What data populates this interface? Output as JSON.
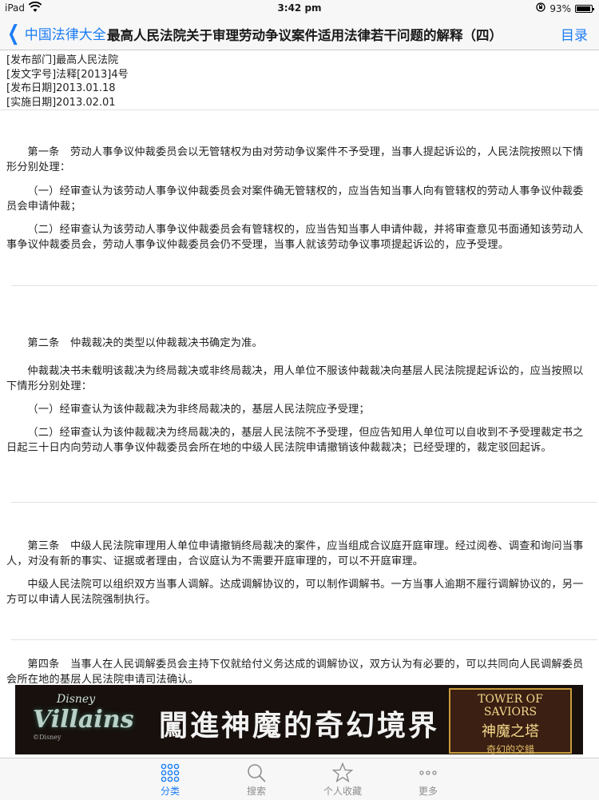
{
  "status": {
    "carrier": "iPad",
    "time": "3:42 pm",
    "battery": "93%",
    "battery_level": 0.93
  },
  "nav": {
    "back_label": "中国法律大全",
    "title": "最高人民法院关于审理劳动争议案件适用法律若干问题的解释（四）",
    "toc_label": "目录"
  },
  "meta": {
    "dept": "[发布部门]最高人民法院",
    "doc_no": "[发文字号]法释[2013]4号",
    "pub_date": "[发布日期]2013.01.18",
    "eff_date": "[实施日期]2013.02.01"
  },
  "articles": {
    "a1_p1": "第一条　劳动人事争议仲裁委员会以无管辖权为由对劳动争议案件不予受理，当事人提起诉讼的，人民法院按照以下情形分别处理：",
    "a1_p2": "（一）经审查认为该劳动人事争议仲裁委员会对案件确无管辖权的，应当告知当事人向有管辖权的劳动人事争议仲裁委员会申请仲裁；",
    "a1_p3": "（二）经审查认为该劳动人事争议仲裁委员会有管辖权的，应当告知当事人申请仲裁，并将审查意见书面通知该劳动人事争议仲裁委员会，劳动人事争议仲裁委员会仍不受理，当事人就该劳动争议事项提起诉讼的，应予受理。",
    "a2_p1": "第二条　仲裁裁决的类型以仲裁裁决书确定为准。",
    "a2_p2": "仲裁裁决书未载明该裁决为终局裁决或非终局裁决，用人单位不服该仲裁裁决向基层人民法院提起诉讼的，应当按照以下情形分别处理：",
    "a2_p3": "（一）经审查认为该仲裁裁决为非终局裁决的，基层人民法院应予受理；",
    "a2_p4": "（二）经审查认为该仲裁裁决为终局裁决的，基层人民法院不予受理，但应告知用人单位可以自收到不予受理裁定书之日起三十日内向劳动人事争议仲裁委员会所在地的中级人民法院申请撤销该仲裁裁决；已经受理的，裁定驳回起诉。",
    "a3_p1": "第三条　中级人民法院审理用人单位申请撤销终局裁决的案件，应当组成合议庭开庭审理。经过阅卷、调查和询问当事人，对没有新的事实、证据或者理由，合议庭认为不需要开庭审理的，可以不开庭审理。",
    "a3_p2": "中级人民法院可以组织双方当事人调解。达成调解协议的，可以制作调解书。一方当事人逾期不履行调解协议的，另一方可以申请人民法院强制执行。",
    "a4_p1": "第四条　当事人在人民调解委员会主持下仅就给付义务达成的调解协议，双方认为有必要的，可以共同向人民调解委员会所在地的基层人民法院申请司法确认。"
  },
  "ad": {
    "brand_small": "Disney",
    "brand_big": "Villains",
    "copyright": "©Disney",
    "headline": "闖進神魔的奇幻境界",
    "game_en": "TOWER OF SAVIORS",
    "game_cn": "神魔之塔",
    "game_sub": "奇幻的交錯"
  },
  "tabs": {
    "t1": "分类",
    "t2": "搜索",
    "t3": "个人收藏",
    "t4": "更多"
  },
  "colors": {
    "accent": "#1b7cf5",
    "tab_inactive": "#8e8e8e"
  }
}
